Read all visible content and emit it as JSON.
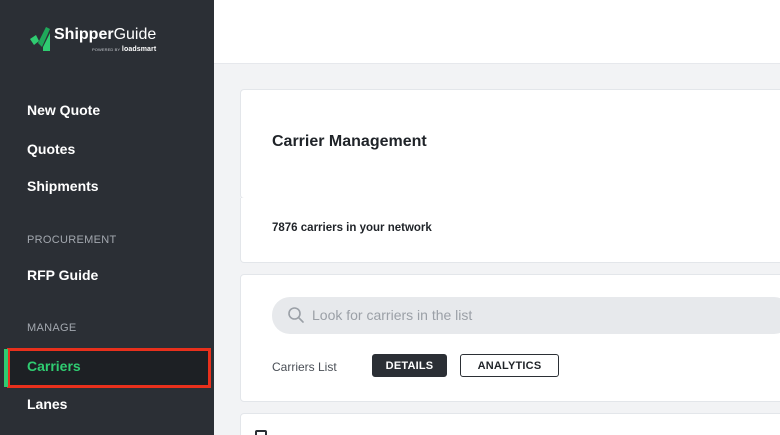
{
  "brand": {
    "name_bold": "Shipper",
    "name_light": "Guide",
    "powered_by": "POWERED BY",
    "powered_brand": "loadsmart",
    "mark_colors": [
      "#2fcc71",
      "#1fa85a"
    ]
  },
  "sidebar": {
    "items": [
      {
        "label": "New Quote"
      },
      {
        "label": "Quotes"
      },
      {
        "label": "Shipments"
      }
    ],
    "procurement_section": "PROCUREMENT",
    "procurement_items": [
      {
        "label": "RFP Guide"
      }
    ],
    "manage_section": "MANAGE",
    "manage_items": [
      {
        "label": "Carriers",
        "active": true
      },
      {
        "label": "Lanes"
      }
    ],
    "active_color": "#2fcc71",
    "highlight_color": "#e8301c"
  },
  "main": {
    "title": "Carrier Management",
    "network_count": "7876 carriers in your network",
    "search": {
      "placeholder": "Look for carriers in the list",
      "icon": "search-icon"
    },
    "list_label": "Carriers List",
    "tabs": [
      {
        "label": "DETAILS",
        "selected": true
      },
      {
        "label": "ANALYTICS",
        "selected": false
      }
    ]
  }
}
